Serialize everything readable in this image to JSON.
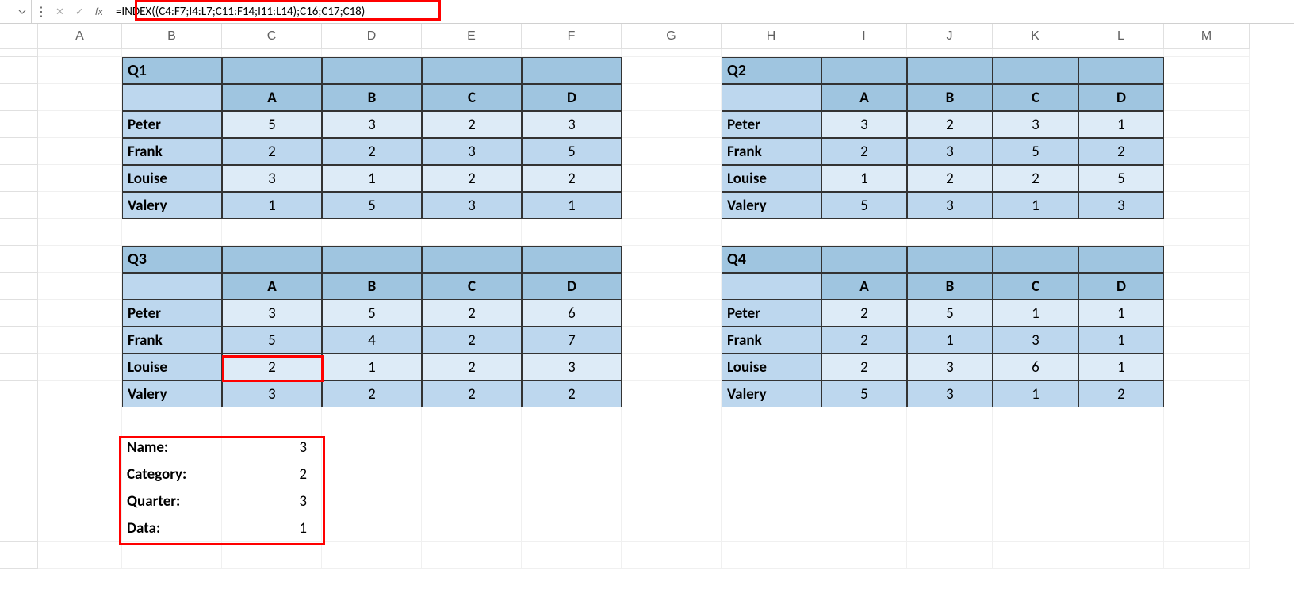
{
  "formula_bar": {
    "formula": "=INDEX((C4:F7;I4:L7;C11:F14;I11:L14);C16;C17;C18)",
    "fx": "fx"
  },
  "cols": [
    "A",
    "B",
    "C",
    "D",
    "E",
    "F",
    "G",
    "H",
    "I",
    "J",
    "K",
    "L",
    "M"
  ],
  "q1": {
    "title": "Q1",
    "headers": [
      "A",
      "B",
      "C",
      "D"
    ],
    "rows": [
      {
        "name": "Peter",
        "v": [
          5,
          3,
          2,
          3
        ]
      },
      {
        "name": "Frank",
        "v": [
          2,
          2,
          3,
          5
        ]
      },
      {
        "name": "Louise",
        "v": [
          3,
          1,
          2,
          2
        ]
      },
      {
        "name": "Valery",
        "v": [
          1,
          5,
          3,
          1
        ]
      }
    ]
  },
  "q2": {
    "title": "Q2",
    "headers": [
      "A",
      "B",
      "C",
      "D"
    ],
    "rows": [
      {
        "name": "Peter",
        "v": [
          3,
          2,
          3,
          1
        ]
      },
      {
        "name": "Frank",
        "v": [
          2,
          3,
          5,
          2
        ]
      },
      {
        "name": "Louise",
        "v": [
          1,
          2,
          2,
          5
        ]
      },
      {
        "name": "Valery",
        "v": [
          5,
          3,
          1,
          3
        ]
      }
    ]
  },
  "q3": {
    "title": "Q3",
    "headers": [
      "A",
      "B",
      "C",
      "D"
    ],
    "rows": [
      {
        "name": "Peter",
        "v": [
          3,
          5,
          2,
          6
        ]
      },
      {
        "name": "Frank",
        "v": [
          5,
          4,
          2,
          7
        ]
      },
      {
        "name": "Louise",
        "v": [
          2,
          1,
          2,
          3
        ]
      },
      {
        "name": "Valery",
        "v": [
          3,
          2,
          2,
          2
        ]
      }
    ]
  },
  "q4": {
    "title": "Q4",
    "headers": [
      "A",
      "B",
      "C",
      "D"
    ],
    "rows": [
      {
        "name": "Peter",
        "v": [
          2,
          5,
          1,
          1
        ]
      },
      {
        "name": "Frank",
        "v": [
          2,
          1,
          3,
          1
        ]
      },
      {
        "name": "Louise",
        "v": [
          2,
          3,
          6,
          1
        ]
      },
      {
        "name": "Valery",
        "v": [
          5,
          3,
          1,
          2
        ]
      }
    ]
  },
  "lookup": {
    "name_label": "Name:",
    "name_val": 3,
    "cat_label": "Category:",
    "cat_val": 2,
    "qtr_label": "Quarter:",
    "qtr_val": 3,
    "data_label": "Data:",
    "data_val": 1
  }
}
